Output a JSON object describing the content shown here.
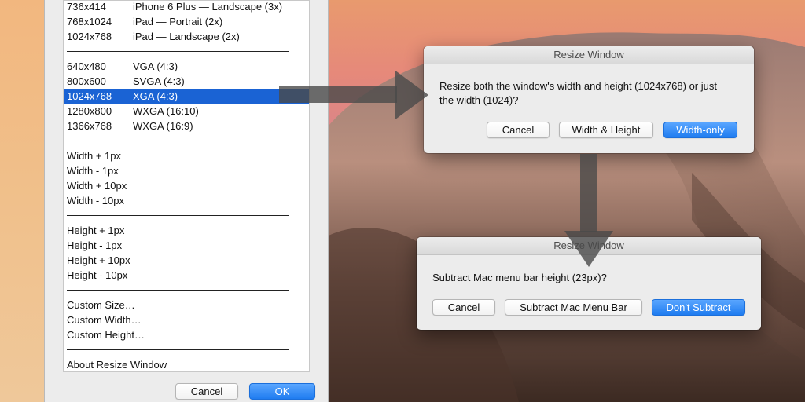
{
  "chooser": {
    "rows": [
      {
        "c1": "736x414",
        "c2": "iPhone 6 Plus — Landscape (3x)"
      },
      {
        "c1": "768x1024",
        "c2": "iPad — Portrait (2x)"
      },
      {
        "c1": "1024x768",
        "c2": "iPad — Landscape (2x)"
      },
      {
        "c1": "640x480",
        "c2": "VGA (4:3)"
      },
      {
        "c1": "800x600",
        "c2": "SVGA (4:3)"
      },
      {
        "c1": "1024x768",
        "c2": "XGA (4:3)"
      },
      {
        "c1": "1280x800",
        "c2": "WXGA (16:10)"
      },
      {
        "c1": "1366x768",
        "c2": "WXGA (16:9)"
      },
      {
        "c1": "Width + 1px",
        "c2": ""
      },
      {
        "c1": "Width - 1px",
        "c2": ""
      },
      {
        "c1": "Width + 10px",
        "c2": ""
      },
      {
        "c1": "Width - 10px",
        "c2": ""
      },
      {
        "c1": "Height + 1px",
        "c2": ""
      },
      {
        "c1": "Height - 1px",
        "c2": ""
      },
      {
        "c1": "Height + 10px",
        "c2": ""
      },
      {
        "c1": "Height - 10px",
        "c2": ""
      },
      {
        "c1": "Custom Size…",
        "c2": ""
      },
      {
        "c1": "Custom Width…",
        "c2": ""
      },
      {
        "c1": "Custom Height…",
        "c2": ""
      },
      {
        "c1": "About Resize Window",
        "c2": ""
      }
    ],
    "cancel_label": "Cancel",
    "ok_label": "OK"
  },
  "dialog1": {
    "title": "Resize Window",
    "message_line1": "Resize both the window's width and height (1024x768) or just",
    "message_line2": "the width (1024)?",
    "cancel_label": "Cancel",
    "both_label": "Width & Height",
    "width_only_label": "Width-only"
  },
  "dialog2": {
    "title": "Resize Window",
    "message": "Subtract Mac menu bar height (23px)?",
    "cancel_label": "Cancel",
    "subtract_label": "Subtract Mac Menu Bar",
    "dont_subtract_label": "Don't Subtract"
  },
  "colors": {
    "selection": "#1a63d4",
    "primary_button": "#1f7cf0",
    "panel_bg": "#ececec"
  }
}
